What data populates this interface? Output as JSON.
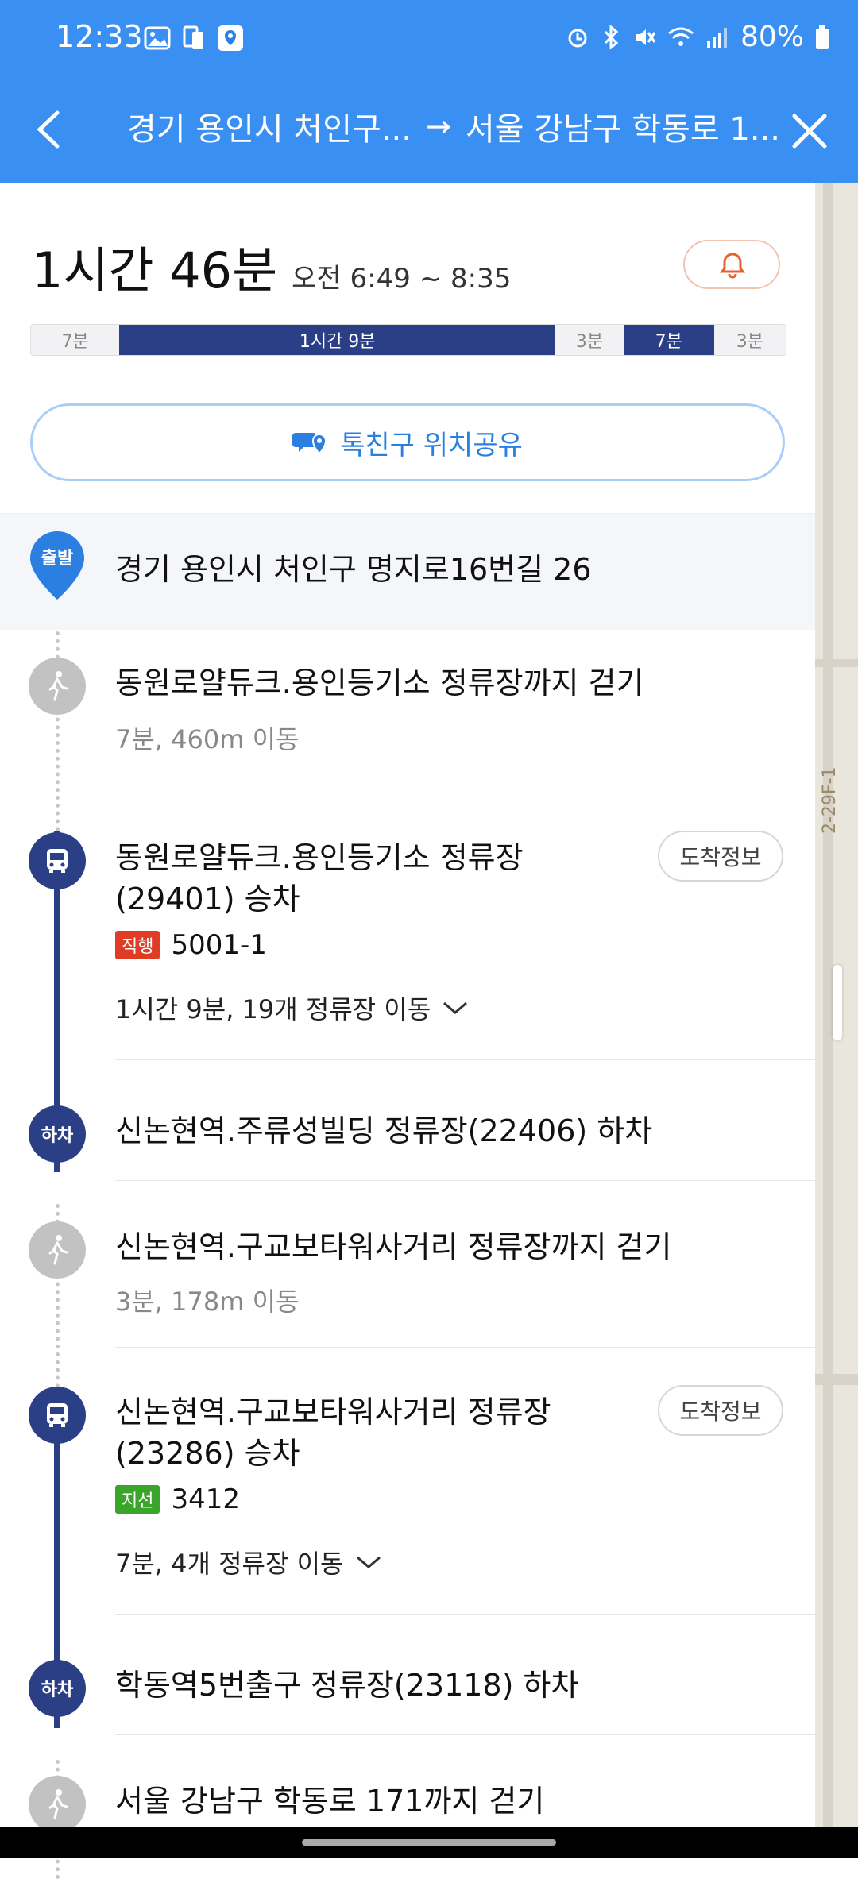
{
  "status": {
    "time": "12:33",
    "battery": "80%"
  },
  "header": {
    "origin": "경기 용인시 처인구...",
    "arrow": "→",
    "destination": "서울 강남구 학동로 1..."
  },
  "summary": {
    "total_time": "1시간 46분",
    "time_range": "오전 6:49 ~ 8:35"
  },
  "timeline": [
    {
      "label": "7분",
      "type": "walk",
      "share": 0.117
    },
    {
      "label": "1시간 9분",
      "type": "bus",
      "share": 0.578
    },
    {
      "label": "3분",
      "type": "walk",
      "share": 0.09
    },
    {
      "label": "7분",
      "type": "bus",
      "share": 0.12
    },
    {
      "label": "3분",
      "type": "walk",
      "share": 0.095
    }
  ],
  "share_button": "톡친구 위치공유",
  "map": {
    "label": "2-29F-1"
  },
  "steps": {
    "start_badge": "출발",
    "start_address": "경기 용인시 처인구 명지로16번길 26",
    "walk1_title": "동원로얄듀크.용인등기소 정류장까지 걷기",
    "walk1_sub": "7분, 460m 이동",
    "board1_title_line1": "동원로얄듀크.용인등기소 정류장",
    "board1_title_line2": "(29401) 승차",
    "board1_badge": "직행",
    "board1_bus": "5001-1",
    "board1_stops": "1시간 9분, 19개 정류장 이동",
    "arrival_info": "도착정보",
    "alight_badge": "하차",
    "alight1_title": "신논현역.주류성빌딩 정류장(22406) 하차",
    "walk2_title": "신논현역.구교보타워사거리 정류장까지 걷기",
    "walk2_sub": "3분, 178m 이동",
    "board2_title_line1": "신논현역.구교보타워사거리 정류장",
    "board2_title_line2": "(23286) 승차",
    "board2_badge": "지선",
    "board2_bus": "3412",
    "board2_stops": "7분, 4개 정류장 이동",
    "alight2_title": "학동역5번출구 정류장(23118) 하차",
    "walk3_title": "서울 강남구 학동로 171까지 걷기"
  }
}
